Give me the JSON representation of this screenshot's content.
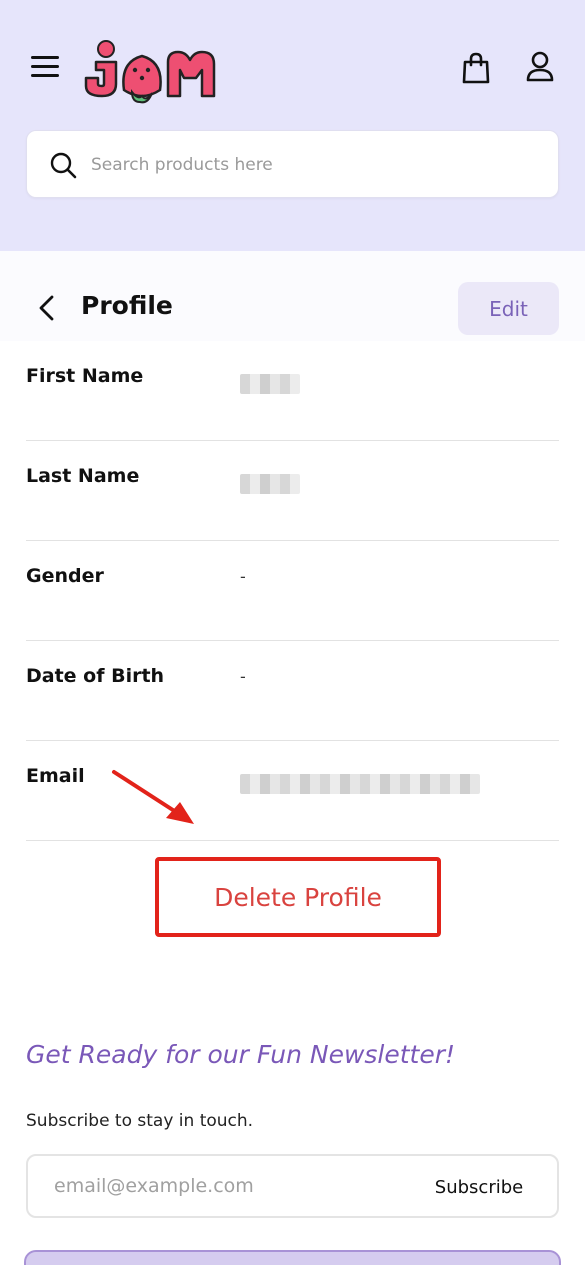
{
  "header": {
    "logo_text": "JAM",
    "search": {
      "placeholder": "Search products here",
      "value": ""
    },
    "icons": {
      "menu": "hamburger-menu-icon",
      "cart": "shopping-bag-icon",
      "account": "user-icon",
      "search": "search-icon"
    }
  },
  "profile": {
    "title": "Profile",
    "edit_label": "Edit",
    "fields": [
      {
        "label": "First Name",
        "value": ""
      },
      {
        "label": "Last Name",
        "value": ""
      },
      {
        "label": "Gender",
        "value": "-"
      },
      {
        "label": "Date of Birth",
        "value": "-"
      },
      {
        "label": "Email",
        "value": ""
      }
    ],
    "delete_label": "Delete Profile"
  },
  "newsletter": {
    "title": "Get Ready for our Fun Newsletter!",
    "subtitle": "Subscribe to stay in touch.",
    "email_placeholder": "email@example.com",
    "subscribe_label": "Subscribe"
  },
  "colors": {
    "header_bg": "#e6e5fb",
    "accent_purple": "#7a58b8",
    "danger_red": "#d9433f",
    "annotation_red": "#e2231a",
    "logo_pink": "#ee4f72",
    "logo_green": "#5fbf7a"
  }
}
